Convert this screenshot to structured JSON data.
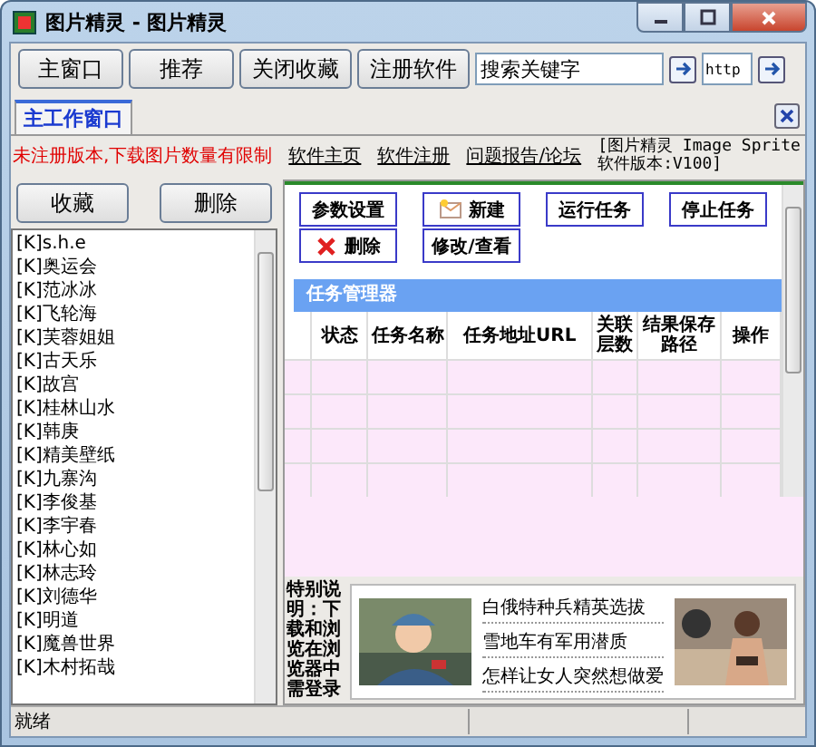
{
  "window": {
    "title": "图片精灵 - 图片精灵"
  },
  "toolbar": {
    "buttons": [
      "主窗口",
      "推荐",
      "关闭收藏",
      "注册软件"
    ],
    "search": {
      "value": "搜索关键字"
    },
    "url": {
      "value": "http"
    }
  },
  "tabs": [
    {
      "label": "主工作窗口",
      "selected": true
    }
  ],
  "notice_bar": {
    "warning": "未注册版本,下载图片数量有限制",
    "links": [
      "软件主页",
      "软件注册",
      "问题报告/论坛"
    ],
    "version": "[图片精灵 Image Sprite 软件版本:V100]"
  },
  "favorites": {
    "buttons": [
      "收藏",
      "删除"
    ],
    "items": [
      "[K]s.h.e",
      "[K]奥运会",
      "[K]范冰冰",
      "[K]飞轮海",
      "[K]芙蓉姐姐",
      "[K]古天乐",
      "[K]故宫",
      "[K]桂林山水",
      "[K]韩庚",
      "[K]精美壁纸",
      "[K]九寨沟",
      "[K]李俊基",
      "[K]李宇春",
      "[K]林心如",
      "[K]林志玲",
      "[K]刘德华",
      "[K]明道",
      "[K]魔兽世界",
      "[K]木村拓哉"
    ]
  },
  "task_panel": {
    "buttons": [
      {
        "label": "参数设置"
      },
      {
        "label": "新建",
        "kind": "new"
      },
      {
        "label": "运行任务"
      },
      {
        "label": "停止任务"
      },
      {
        "label": "删除",
        "kind": "delete"
      },
      {
        "label": "修改/查看"
      }
    ]
  },
  "task_manager": {
    "title": "任务管理器",
    "columns": [
      "状态",
      "任务名称",
      "任务地址URL",
      "关联层数",
      "结果保存路径",
      "操作"
    ]
  },
  "note": "特别说明：下载和浏览在浏览器中需登录",
  "ads": {
    "headlines": [
      "白俄特种兵精英选拔",
      "雪地车有军用潜质",
      "怎样让女人突然想做爱"
    ]
  },
  "status_bar": {
    "text": "就绪"
  }
}
